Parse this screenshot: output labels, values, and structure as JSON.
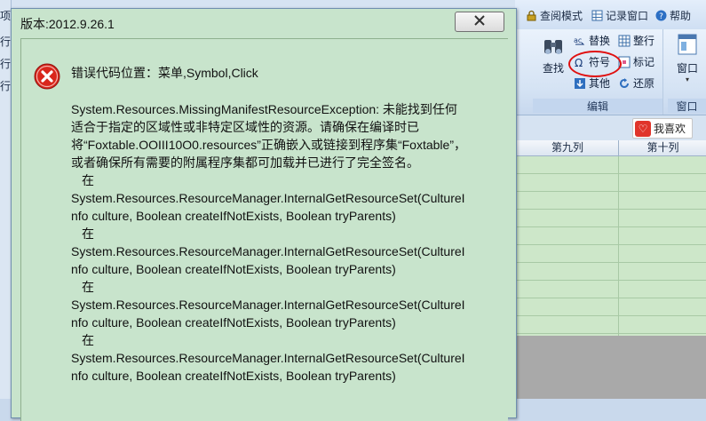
{
  "app": {
    "topbar": [
      {
        "label": "查阅模式",
        "icon": "lock-icon"
      },
      {
        "label": "记录窗口",
        "icon": "table-icon"
      },
      {
        "label": "帮助",
        "icon": "help-icon"
      }
    ],
    "left_strip": [
      "项",
      "行",
      "行",
      "行"
    ],
    "ribbon": {
      "find_group": {
        "find_label": "查找",
        "replace_label": "替换",
        "symbol_label": "符号",
        "other_label": "其他",
        "adjust_label": "整行",
        "mark_label": "标记",
        "restore_label": "还原",
        "group_label": "编辑"
      },
      "window_group": {
        "window_label": "窗口",
        "group_label": "窗口"
      }
    },
    "like_button": "我喜欢",
    "grid": {
      "columns": [
        "第九列",
        "第十列"
      ]
    }
  },
  "dialog": {
    "title": "版本:2012.9.26.1",
    "heading": "错误代码位置：菜单,Symbol,Click",
    "message": "System.Resources.MissingManifestResourceException: 未能找到任何适合于指定的区域性或非特定区域性的资源。请确保在编译时已将“Foxtable.OOIII10O0.resources”正确嵌入或链接到程序集“Foxtable”，或者确保所有需要的附属程序集都可加载并已进行了完全签名。",
    "stack": [
      {
        "at": "在",
        "frame": "System.Resources.ResourceManager.InternalGetResourceSet(CultureInfo culture, Boolean createIfNotExists, Boolean tryParents)"
      },
      {
        "at": "在",
        "frame": "System.Resources.ResourceManager.InternalGetResourceSet(CultureInfo culture, Boolean createIfNotExists, Boolean tryParents)"
      },
      {
        "at": "在",
        "frame": "System.Resources.ResourceManager.InternalGetResourceSet(CultureInfo culture, Boolean createIfNotExists, Boolean tryParents)"
      },
      {
        "at": "在",
        "frame": "System.Resources.ResourceManager.InternalGetResourceSet(CultureInfo culture, Boolean createIfNotExists, Boolean tryParents)"
      }
    ]
  },
  "colors": {
    "dialog_bg": "#c8e4cc",
    "error_red": "#d9261c",
    "highlight_circle": "#e01010"
  }
}
